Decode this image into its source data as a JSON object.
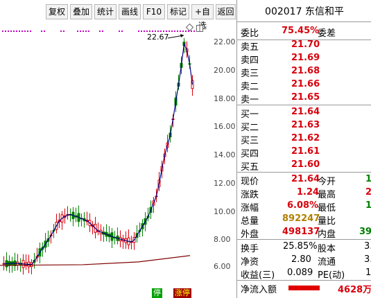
{
  "toolbar": {
    "buttons": [
      "复权",
      "叠加",
      "统计",
      "画线",
      "F10",
      "标记",
      "+自选",
      "返回"
    ]
  },
  "chart": {
    "high_label": "22.67",
    "price_ticks": [
      "22.00",
      "20.00",
      "18.00",
      "16.00",
      "14.00",
      "12.00",
      "10.00",
      "8.00",
      "6.00"
    ],
    "bottom_tags": [
      "停",
      "涨停"
    ],
    "colors": {
      "up": "#d8000c",
      "down": "#008000",
      "ma": "#000080",
      "long_ma": "#800000",
      "marker": "#c000c0"
    }
  },
  "quote": {
    "title": "002017 东信和平",
    "wei_bi_label": "委比",
    "wei_bi_value": "75.45%",
    "wei_cha_label": "委差",
    "sell": [
      {
        "label": "卖五",
        "price": "21.70"
      },
      {
        "label": "卖四",
        "price": "21.69"
      },
      {
        "label": "卖三",
        "price": "21.68"
      },
      {
        "label": "卖二",
        "price": "21.66"
      },
      {
        "label": "卖一",
        "price": "21.65"
      }
    ],
    "buy": [
      {
        "label": "买一",
        "price": "21.64"
      },
      {
        "label": "买二",
        "price": "21.63"
      },
      {
        "label": "买三",
        "price": "21.62"
      },
      {
        "label": "买四",
        "price": "21.61"
      },
      {
        "label": "买五",
        "price": "21.60"
      }
    ],
    "stats": [
      {
        "l1": "现价",
        "v1": "21.64",
        "l2": "今开",
        "v2": "1"
      },
      {
        "l1": "涨跌",
        "v1": "1.24",
        "l2": "最高",
        "v2": "2"
      },
      {
        "l1": "涨幅",
        "v1": "6.08%",
        "l2": "最低",
        "v2": "1"
      },
      {
        "l1": "总量",
        "v1": "892247",
        "l2": "量比",
        "v2": ""
      },
      {
        "l1": "外盘",
        "v1": "498137",
        "l2": "内盘",
        "v2": "39"
      }
    ],
    "extra": [
      {
        "l1": "换手",
        "v1": "25.85%",
        "l2": "股本",
        "v2": "3."
      },
      {
        "l1": "净资",
        "v1": "2.80",
        "l2": "流通",
        "v2": "3."
      },
      {
        "l1": "收益(三)",
        "v1": "0.089",
        "l2": "PE(动)",
        "v2": "1"
      }
    ],
    "net_inflow_label": "净流入额",
    "net_inflow_value": "4628万"
  }
}
